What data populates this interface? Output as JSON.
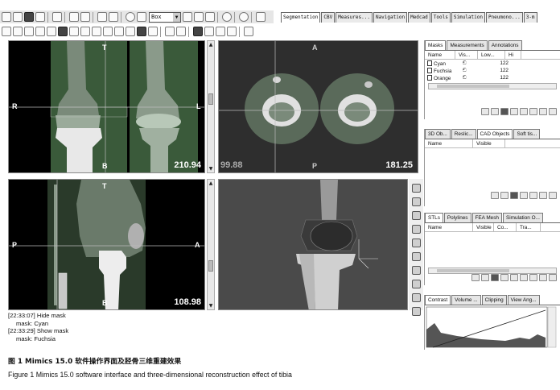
{
  "tabs": [
    "Segmentation",
    "CBV",
    "Measures...",
    "Navigation",
    "Medcad",
    "Tools",
    "Simulation",
    "Pneumono...",
    "3-m"
  ],
  "toolbar": {
    "zoom_select": "Box"
  },
  "viewports": {
    "frontal": {
      "top": "T",
      "left": "R",
      "right": "L",
      "bottom": "B",
      "value": "210.94"
    },
    "axial": {
      "top": "A",
      "bottom": "P",
      "value_left": "99.88",
      "value_right": "181.25"
    },
    "sagittal": {
      "top": "T",
      "left": "P",
      "right": "A",
      "bottom": "B",
      "value": "108.98"
    }
  },
  "log": [
    {
      "text": "[22:33:07] Hide mask",
      "indent": false
    },
    {
      "text": "mask: Cyan",
      "indent": true
    },
    {
      "text": "[22:33:29] Show mask",
      "indent": false
    },
    {
      "text": "mask: Fuchsia",
      "indent": true
    }
  ],
  "masks_panel": {
    "tabs": [
      "Masks",
      "Measurements",
      "Annotations"
    ],
    "columns": [
      "Name",
      "Vis...",
      "Low...",
      "Hi"
    ],
    "rows": [
      {
        "name": "Cyan",
        "visible": "ඞ",
        "low": "122"
      },
      {
        "name": "Fuchsia",
        "visible": "ඞ",
        "low": "122"
      },
      {
        "name": "Orange",
        "visible": "ඞ",
        "low": "122"
      }
    ]
  },
  "cad_panel": {
    "tabs": [
      "3D Ob...",
      "Reslic...",
      "CAD Objects",
      "Soft tis..."
    ],
    "columns": [
      "Name",
      "Visible"
    ]
  },
  "stl_panel": {
    "tabs": [
      "STLs",
      "Polylines",
      "FEA Mesh",
      "Simulation O..."
    ],
    "columns": [
      "Name",
      "Visible",
      "Co...",
      "Tra..."
    ]
  },
  "contrast_panel": {
    "tabs": [
      "Contrast",
      "Volume ...",
      "Clipping",
      "View Ang..."
    ]
  },
  "caption": {
    "cn": "图 1    Mimics 15.0 软件操作界面及胫骨三维重建效果",
    "en": "Figure 1    Mimics 15.0 software interface and three-dimensional reconstruction effect of tibia"
  }
}
